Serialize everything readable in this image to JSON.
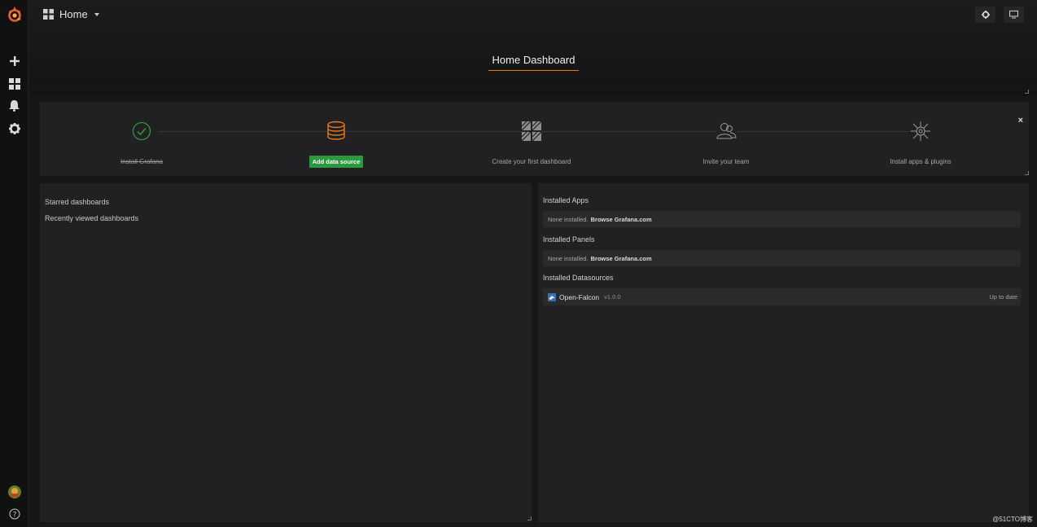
{
  "topbar": {
    "dashboard_picker": "Home"
  },
  "dashboard": {
    "title": "Home Dashboard"
  },
  "steps": [
    {
      "label": "Install Grafana",
      "done": true
    },
    {
      "label": "Add data source",
      "is_button": true
    },
    {
      "label": "Create your first dashboard"
    },
    {
      "label": "Invite your team"
    },
    {
      "label": "Install apps & plugins"
    }
  ],
  "steps_close": "×",
  "left_panel": {
    "starred": "Starred dashboards",
    "recent": "Recently viewed dashboards"
  },
  "right_panel": {
    "apps_heading": "Installed Apps",
    "apps_none": "None installed.",
    "apps_link": "Browse Grafana.com",
    "panels_heading": "Installed Panels",
    "panels_none": "None installed.",
    "panels_link": "Browse Grafana.com",
    "datasources_heading": "Installed Datasources",
    "datasource": {
      "name": "Open-Falcon",
      "version": "v1.0.0",
      "status": "Up to date"
    }
  },
  "watermark": "@51CTO博客",
  "colors": {
    "accent": "#eb7b18",
    "success": "#2b9a3f",
    "background": "#161719",
    "panel": "#212124"
  }
}
